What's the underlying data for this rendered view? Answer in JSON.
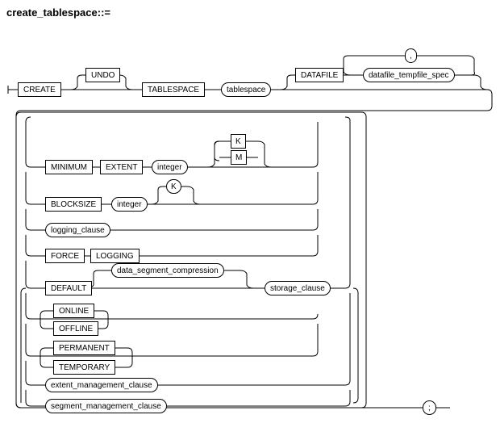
{
  "title": "create_tablespace::=",
  "nodes": {
    "create": "CREATE",
    "undo": "UNDO",
    "tablespace": "TABLESPACE",
    "tablespace_name": "tablespace",
    "datafile": "DATAFILE",
    "datafile_tempfile_spec": "datafile_tempfile_spec",
    "comma": ",",
    "minimum": "MINIMUM",
    "extent": "EXTENT",
    "integer1": "integer",
    "k": "K",
    "m": "M",
    "blocksize": "BLOCKSIZE",
    "integer2": "integer",
    "k2": "K",
    "logging_clause": "logging_clause",
    "force": "FORCE",
    "logging": "LOGGING",
    "default": "DEFAULT",
    "data_segment_compression": "data_segment_compression",
    "storage_clause": "storage_clause",
    "online": "ONLINE",
    "offline": "OFFLINE",
    "permanent": "PERMANENT",
    "temporary": "TEMPORARY",
    "extent_management_clause": "extent_management_clause",
    "segment_management_clause": "segment_management_clause",
    "semicolon": ";"
  }
}
